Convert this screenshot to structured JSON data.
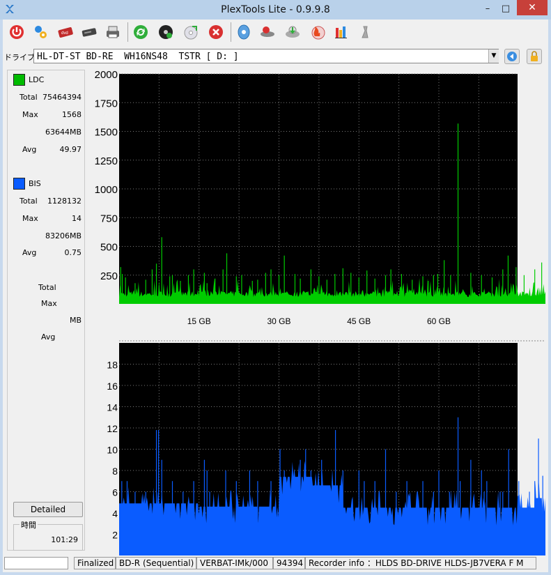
{
  "window": {
    "title": "PlexTools Lite - 0.9.9.8",
    "minimize": "–",
    "maximize": "□",
    "close": "✕"
  },
  "toolbar": {
    "icons": [
      "power-icon",
      "settings-icon",
      "dvd-icon",
      "drive-icon",
      "print-icon",
      "refresh-icon",
      "disc-test-icon",
      "disc-check-icon",
      "stop-icon",
      "disc-info-icon",
      "eject-icon",
      "transfer-icon",
      "burn-icon",
      "chart-icon",
      "tool-icon"
    ]
  },
  "drive": {
    "label": "ドライブ:",
    "selected": "HL-DT-ST BD-RE  WH16NS48  TSTR [ D: ]"
  },
  "left_panel": {
    "ldc": {
      "name": "LDC",
      "color": "#00bb00",
      "total_label": "Total",
      "total": "75464394",
      "max_label": "Max",
      "max": "1568",
      "max_pos": "63644MB",
      "avg_label": "Avg",
      "avg": "49.97"
    },
    "bis": {
      "name": "BIS",
      "color": "#0a5cff",
      "total_label": "Total",
      "total": "1128132",
      "max_label": "Max",
      "max": "14",
      "max_pos": "83206MB",
      "avg_label": "Avg",
      "avg": "0.75"
    },
    "third": {
      "total_label": "Total",
      "max_label": "Max",
      "mb_label": "MB",
      "avg_label": "Avg"
    },
    "detailed_button": "Detailed",
    "time_label": "時間",
    "time_value": "101:29"
  },
  "status": {
    "state": "Finalized",
    "media": "BD-R (Sequential)",
    "media_id": "VERBAT-IMk/000",
    "count": "94394",
    "recorder_info": "Recorder info ：HLDS BD-DRIVE   HLDS-JB7VERA   F M"
  },
  "chart_data": [
    {
      "type": "area",
      "series": [
        {
          "name": "LDC",
          "color": "#00cc00"
        }
      ],
      "xlabel": "",
      "ylabel": "",
      "x_ticks": [
        "15 GB",
        "30 GB",
        "45 GB",
        "60 GB"
      ],
      "x_tick_values": [
        15,
        30,
        45,
        60
      ],
      "xlim": [
        0,
        80
      ],
      "y_ticks": [
        "250",
        "500",
        "750",
        "1000",
        "1250",
        "1500",
        "1750",
        "2000"
      ],
      "y_tick_values": [
        250,
        500,
        750,
        1000,
        1250,
        1500,
        1750,
        2000
      ],
      "ylim": [
        0,
        2000
      ],
      "baseline": 60,
      "noise": 40,
      "spikes": [
        [
          0.3,
          320
        ],
        [
          0.6,
          260
        ],
        [
          1.2,
          230
        ],
        [
          3,
          180
        ],
        [
          5,
          210
        ],
        [
          6.2,
          300
        ],
        [
          7,
          350
        ],
        [
          8,
          580
        ],
        [
          9.5,
          240
        ],
        [
          10,
          250
        ],
        [
          11.5,
          200
        ],
        [
          13,
          250
        ],
        [
          14,
          300
        ],
        [
          16,
          270
        ],
        [
          16.5,
          180
        ],
        [
          18,
          220
        ],
        [
          19.5,
          300
        ],
        [
          20.2,
          440
        ],
        [
          22,
          240
        ],
        [
          23,
          250
        ],
        [
          25,
          200
        ],
        [
          26,
          210
        ],
        [
          27.5,
          270
        ],
        [
          28.5,
          300
        ],
        [
          30,
          250
        ],
        [
          31,
          420
        ],
        [
          33,
          260
        ],
        [
          34,
          220
        ],
        [
          36,
          300
        ],
        [
          37.5,
          240
        ],
        [
          39,
          210
        ],
        [
          40.5,
          260
        ],
        [
          42,
          310
        ],
        [
          43.5,
          270
        ],
        [
          45,
          230
        ],
        [
          46.5,
          290
        ],
        [
          48,
          220
        ],
        [
          50,
          250
        ],
        [
          51,
          300
        ],
        [
          53,
          260
        ],
        [
          55,
          210
        ],
        [
          57,
          240
        ],
        [
          58,
          200
        ],
        [
          59,
          250
        ],
        [
          59.8,
          260
        ],
        [
          61,
          380
        ],
        [
          62.2,
          250
        ],
        [
          63.6,
          1568
        ],
        [
          66,
          270
        ],
        [
          68,
          250
        ],
        [
          70,
          230
        ],
        [
          72,
          300
        ],
        [
          73,
          420
        ],
        [
          74.5,
          320
        ],
        [
          76,
          250
        ],
        [
          78,
          300
        ],
        [
          79.3,
          360
        ]
      ],
      "grid": true,
      "legend": "none"
    },
    {
      "type": "area",
      "series": [
        {
          "name": "BIS",
          "color": "#0a5cff"
        }
      ],
      "xlabel": "",
      "ylabel": "",
      "x_ticks": [
        "15 GB",
        "30 GB",
        "45 GB",
        "60 GB"
      ],
      "x_tick_values": [
        15,
        30,
        45,
        60
      ],
      "xlim": [
        0,
        80
      ],
      "y_ticks": [
        "2",
        "4",
        "6",
        "8",
        "10",
        "12",
        "14",
        "16",
        "18"
      ],
      "y_tick_values": [
        2,
        4,
        6,
        8,
        10,
        12,
        14,
        16,
        18
      ],
      "ylim": [
        0,
        20
      ],
      "segments": [
        [
          0,
          15,
          4.9
        ],
        [
          15,
          30,
          4.6
        ],
        [
          30,
          36.5,
          7.4
        ],
        [
          36.5,
          42,
          6.6
        ],
        [
          42,
          78,
          4.5
        ],
        [
          78,
          80,
          5.4
        ]
      ],
      "spikes": [
        [
          0.5,
          7
        ],
        [
          1.5,
          7
        ],
        [
          3,
          6
        ],
        [
          5,
          6
        ],
        [
          7,
          11.8
        ],
        [
          7.4,
          11.8
        ],
        [
          8,
          9
        ],
        [
          10,
          7
        ],
        [
          12,
          6
        ],
        [
          14,
          7
        ],
        [
          16,
          9
        ],
        [
          16.5,
          8
        ],
        [
          17,
          6
        ],
        [
          20,
          8
        ],
        [
          22,
          7
        ],
        [
          24.5,
          8
        ],
        [
          26,
          7
        ],
        [
          28.5,
          7
        ],
        [
          30.2,
          10
        ],
        [
          31,
          8
        ],
        [
          34,
          9
        ],
        [
          35,
          10
        ],
        [
          36,
          8
        ],
        [
          38,
          9
        ],
        [
          40,
          7
        ],
        [
          40.6,
          11.8
        ],
        [
          42,
          8
        ],
        [
          45,
          8
        ],
        [
          46,
          7
        ],
        [
          48,
          7
        ],
        [
          50,
          10
        ],
        [
          52,
          6
        ],
        [
          54,
          7
        ],
        [
          56,
          6
        ],
        [
          57,
          7
        ],
        [
          59,
          6
        ],
        [
          60,
          8
        ],
        [
          62,
          6
        ],
        [
          63.6,
          13
        ],
        [
          64,
          7
        ],
        [
          66,
          9
        ],
        [
          68,
          8
        ],
        [
          68.5,
          6
        ],
        [
          69,
          7
        ],
        [
          71.5,
          6
        ],
        [
          72,
          6
        ],
        [
          73.1,
          10
        ],
        [
          75,
          7
        ],
        [
          77,
          6
        ],
        [
          78,
          7
        ],
        [
          78.7,
          11
        ],
        [
          79.5,
          7.5
        ]
      ],
      "grid": true,
      "legend": "none"
    }
  ]
}
